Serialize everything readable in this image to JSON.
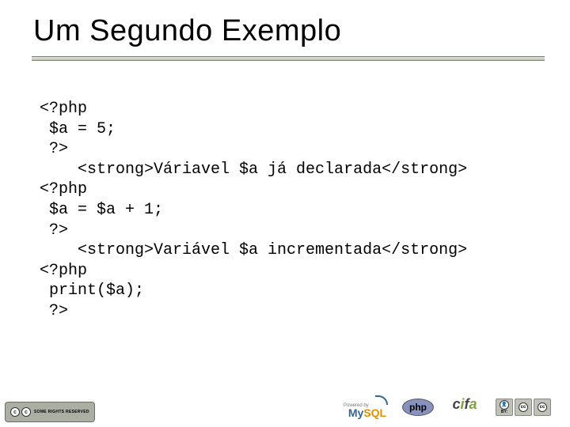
{
  "slide": {
    "title": "Um Segundo Exemplo"
  },
  "code": {
    "l1": "<?php",
    "l2": "$a = 5;",
    "l3": "?>",
    "l4": "    <strong>Váriavel $a já declarada</strong>",
    "l5": "<?php",
    "l6": "$a = $a + 1;",
    "l7": "?>",
    "l8": "    <strong>Variável $a incrementada</strong>",
    "l9": "<?php",
    "l10": "print($a);",
    "l11": "?>"
  },
  "footer": {
    "cc_rights": "SOME RIGHTS RESERVED",
    "mysql_powered": "Powered by",
    "mysql_my": "My",
    "mysql_sql": "SQL",
    "php": "php",
    "cifa_c": "c",
    "cifa_i": "i",
    "cifa_f": "f",
    "cifa_a": "a",
    "by_label": "BY:",
    "cc_glyph": "cc",
    "person_glyph": "●"
  }
}
